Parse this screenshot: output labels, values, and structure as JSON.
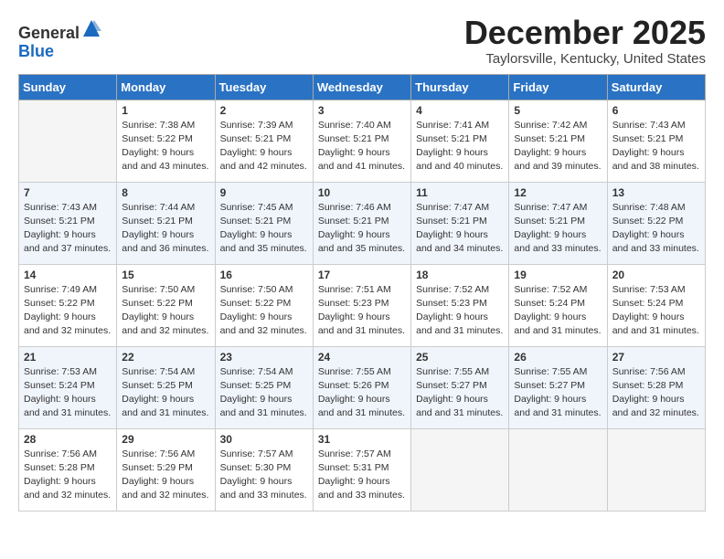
{
  "header": {
    "logo_general": "General",
    "logo_blue": "Blue",
    "month": "December 2025",
    "location": "Taylorsville, Kentucky, United States"
  },
  "days_of_week": [
    "Sunday",
    "Monday",
    "Tuesday",
    "Wednesday",
    "Thursday",
    "Friday",
    "Saturday"
  ],
  "weeks": [
    [
      {
        "day": "",
        "sunrise": "",
        "sunset": "",
        "daylight": ""
      },
      {
        "day": "1",
        "sunrise": "Sunrise: 7:38 AM",
        "sunset": "Sunset: 5:22 PM",
        "daylight": "Daylight: 9 hours and 43 minutes."
      },
      {
        "day": "2",
        "sunrise": "Sunrise: 7:39 AM",
        "sunset": "Sunset: 5:21 PM",
        "daylight": "Daylight: 9 hours and 42 minutes."
      },
      {
        "day": "3",
        "sunrise": "Sunrise: 7:40 AM",
        "sunset": "Sunset: 5:21 PM",
        "daylight": "Daylight: 9 hours and 41 minutes."
      },
      {
        "day": "4",
        "sunrise": "Sunrise: 7:41 AM",
        "sunset": "Sunset: 5:21 PM",
        "daylight": "Daylight: 9 hours and 40 minutes."
      },
      {
        "day": "5",
        "sunrise": "Sunrise: 7:42 AM",
        "sunset": "Sunset: 5:21 PM",
        "daylight": "Daylight: 9 hours and 39 minutes."
      },
      {
        "day": "6",
        "sunrise": "Sunrise: 7:43 AM",
        "sunset": "Sunset: 5:21 PM",
        "daylight": "Daylight: 9 hours and 38 minutes."
      }
    ],
    [
      {
        "day": "7",
        "sunrise": "Sunrise: 7:43 AM",
        "sunset": "Sunset: 5:21 PM",
        "daylight": "Daylight: 9 hours and 37 minutes."
      },
      {
        "day": "8",
        "sunrise": "Sunrise: 7:44 AM",
        "sunset": "Sunset: 5:21 PM",
        "daylight": "Daylight: 9 hours and 36 minutes."
      },
      {
        "day": "9",
        "sunrise": "Sunrise: 7:45 AM",
        "sunset": "Sunset: 5:21 PM",
        "daylight": "Daylight: 9 hours and 35 minutes."
      },
      {
        "day": "10",
        "sunrise": "Sunrise: 7:46 AM",
        "sunset": "Sunset: 5:21 PM",
        "daylight": "Daylight: 9 hours and 35 minutes."
      },
      {
        "day": "11",
        "sunrise": "Sunrise: 7:47 AM",
        "sunset": "Sunset: 5:21 PM",
        "daylight": "Daylight: 9 hours and 34 minutes."
      },
      {
        "day": "12",
        "sunrise": "Sunrise: 7:47 AM",
        "sunset": "Sunset: 5:21 PM",
        "daylight": "Daylight: 9 hours and 33 minutes."
      },
      {
        "day": "13",
        "sunrise": "Sunrise: 7:48 AM",
        "sunset": "Sunset: 5:22 PM",
        "daylight": "Daylight: 9 hours and 33 minutes."
      }
    ],
    [
      {
        "day": "14",
        "sunrise": "Sunrise: 7:49 AM",
        "sunset": "Sunset: 5:22 PM",
        "daylight": "Daylight: 9 hours and 32 minutes."
      },
      {
        "day": "15",
        "sunrise": "Sunrise: 7:50 AM",
        "sunset": "Sunset: 5:22 PM",
        "daylight": "Daylight: 9 hours and 32 minutes."
      },
      {
        "day": "16",
        "sunrise": "Sunrise: 7:50 AM",
        "sunset": "Sunset: 5:22 PM",
        "daylight": "Daylight: 9 hours and 32 minutes."
      },
      {
        "day": "17",
        "sunrise": "Sunrise: 7:51 AM",
        "sunset": "Sunset: 5:23 PM",
        "daylight": "Daylight: 9 hours and 31 minutes."
      },
      {
        "day": "18",
        "sunrise": "Sunrise: 7:52 AM",
        "sunset": "Sunset: 5:23 PM",
        "daylight": "Daylight: 9 hours and 31 minutes."
      },
      {
        "day": "19",
        "sunrise": "Sunrise: 7:52 AM",
        "sunset": "Sunset: 5:24 PM",
        "daylight": "Daylight: 9 hours and 31 minutes."
      },
      {
        "day": "20",
        "sunrise": "Sunrise: 7:53 AM",
        "sunset": "Sunset: 5:24 PM",
        "daylight": "Daylight: 9 hours and 31 minutes."
      }
    ],
    [
      {
        "day": "21",
        "sunrise": "Sunrise: 7:53 AM",
        "sunset": "Sunset: 5:24 PM",
        "daylight": "Daylight: 9 hours and 31 minutes."
      },
      {
        "day": "22",
        "sunrise": "Sunrise: 7:54 AM",
        "sunset": "Sunset: 5:25 PM",
        "daylight": "Daylight: 9 hours and 31 minutes."
      },
      {
        "day": "23",
        "sunrise": "Sunrise: 7:54 AM",
        "sunset": "Sunset: 5:25 PM",
        "daylight": "Daylight: 9 hours and 31 minutes."
      },
      {
        "day": "24",
        "sunrise": "Sunrise: 7:55 AM",
        "sunset": "Sunset: 5:26 PM",
        "daylight": "Daylight: 9 hours and 31 minutes."
      },
      {
        "day": "25",
        "sunrise": "Sunrise: 7:55 AM",
        "sunset": "Sunset: 5:27 PM",
        "daylight": "Daylight: 9 hours and 31 minutes."
      },
      {
        "day": "26",
        "sunrise": "Sunrise: 7:55 AM",
        "sunset": "Sunset: 5:27 PM",
        "daylight": "Daylight: 9 hours and 31 minutes."
      },
      {
        "day": "27",
        "sunrise": "Sunrise: 7:56 AM",
        "sunset": "Sunset: 5:28 PM",
        "daylight": "Daylight: 9 hours and 32 minutes."
      }
    ],
    [
      {
        "day": "28",
        "sunrise": "Sunrise: 7:56 AM",
        "sunset": "Sunset: 5:28 PM",
        "daylight": "Daylight: 9 hours and 32 minutes."
      },
      {
        "day": "29",
        "sunrise": "Sunrise: 7:56 AM",
        "sunset": "Sunset: 5:29 PM",
        "daylight": "Daylight: 9 hours and 32 minutes."
      },
      {
        "day": "30",
        "sunrise": "Sunrise: 7:57 AM",
        "sunset": "Sunset: 5:30 PM",
        "daylight": "Daylight: 9 hours and 33 minutes."
      },
      {
        "day": "31",
        "sunrise": "Sunrise: 7:57 AM",
        "sunset": "Sunset: 5:31 PM",
        "daylight": "Daylight: 9 hours and 33 minutes."
      },
      {
        "day": "",
        "sunrise": "",
        "sunset": "",
        "daylight": ""
      },
      {
        "day": "",
        "sunrise": "",
        "sunset": "",
        "daylight": ""
      },
      {
        "day": "",
        "sunrise": "",
        "sunset": "",
        "daylight": ""
      }
    ]
  ]
}
